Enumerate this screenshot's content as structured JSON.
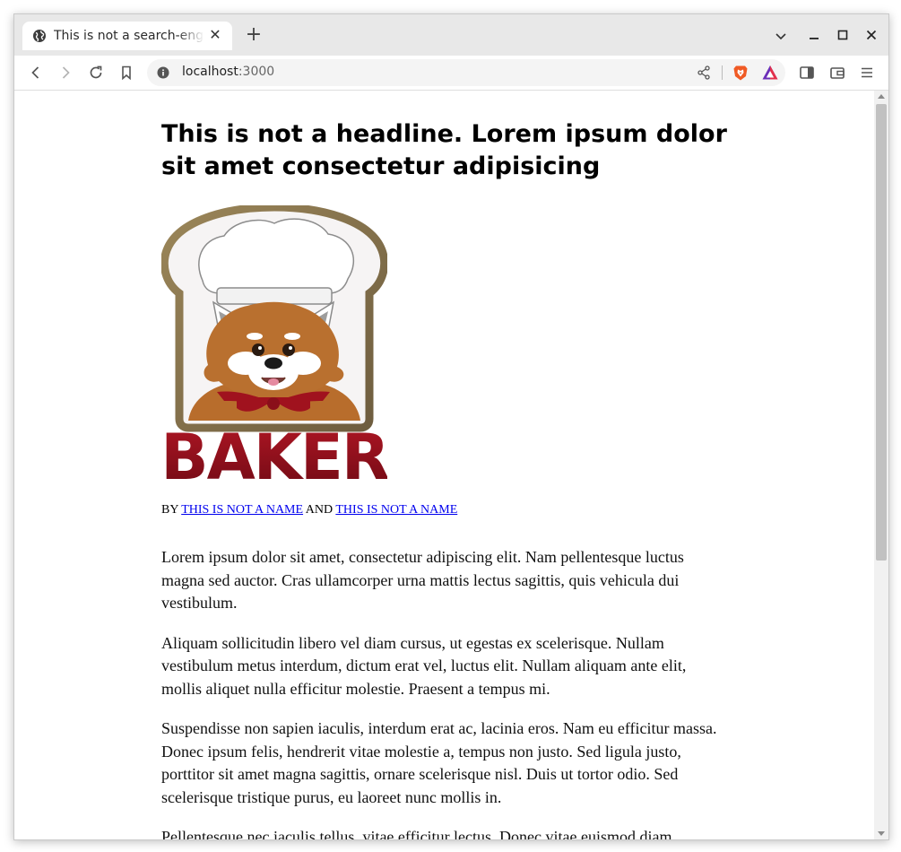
{
  "browser": {
    "tab_title": "This is not a search-engine-optimized title",
    "url_host": "localhost",
    "url_port": ":3000",
    "icons": [
      "globe-icon",
      "close-icon",
      "plus-icon",
      "chevron-down-icon",
      "minimize-icon",
      "maximize-icon",
      "window-close-icon",
      "back-icon",
      "forward-icon",
      "reload-icon",
      "bookmark-icon",
      "info-icon",
      "share-icon",
      "brave-shields-icon",
      "brave-rewards-icon",
      "sidebar-icon",
      "wallet-icon",
      "menu-icon"
    ]
  },
  "article": {
    "headline": "This is not a headline. Lorem ipsum dolor sit amet consectetur adipisicing",
    "logo_text": "BAKER",
    "byline_prefix": "BY ",
    "author_1": "THIS IS NOT A NAME",
    "byline_and": " AND ",
    "author_2": "THIS IS NOT A NAME",
    "paragraphs": [
      "Lorem ipsum dolor sit amet, consectetur adipiscing elit. Nam pellentesque luctus magna sed auctor. Cras ullamcorper urna mattis lectus sagittis, quis vehicula dui vestibulum.",
      "Aliquam sollicitudin libero vel diam cursus, ut egestas ex scelerisque. Nullam vestibulum metus interdum, dictum erat vel, luctus elit. Nullam aliquam ante elit, mollis aliquet nulla efficitur molestie. Praesent a tempus mi.",
      "Suspendisse non sapien iaculis, interdum erat ac, lacinia eros. Nam eu efficitur massa. Donec ipsum felis, hendrerit vitae molestie a, tempus non justo. Sed ligula justo, porttitor sit amet magna sagittis, ornare scelerisque nisl. Duis ut tortor odio. Sed scelerisque tristique purus, eu laoreet nunc mollis in.",
      "Pellentesque nec iaculis tellus, vitae efficitur lectus. Donec vitae euismod diam."
    ]
  },
  "colors": {
    "link": "#0000ee",
    "logo_red": "#8e0f1c",
    "logo_frame": "#8c7750",
    "fur": "#b86d2c"
  }
}
